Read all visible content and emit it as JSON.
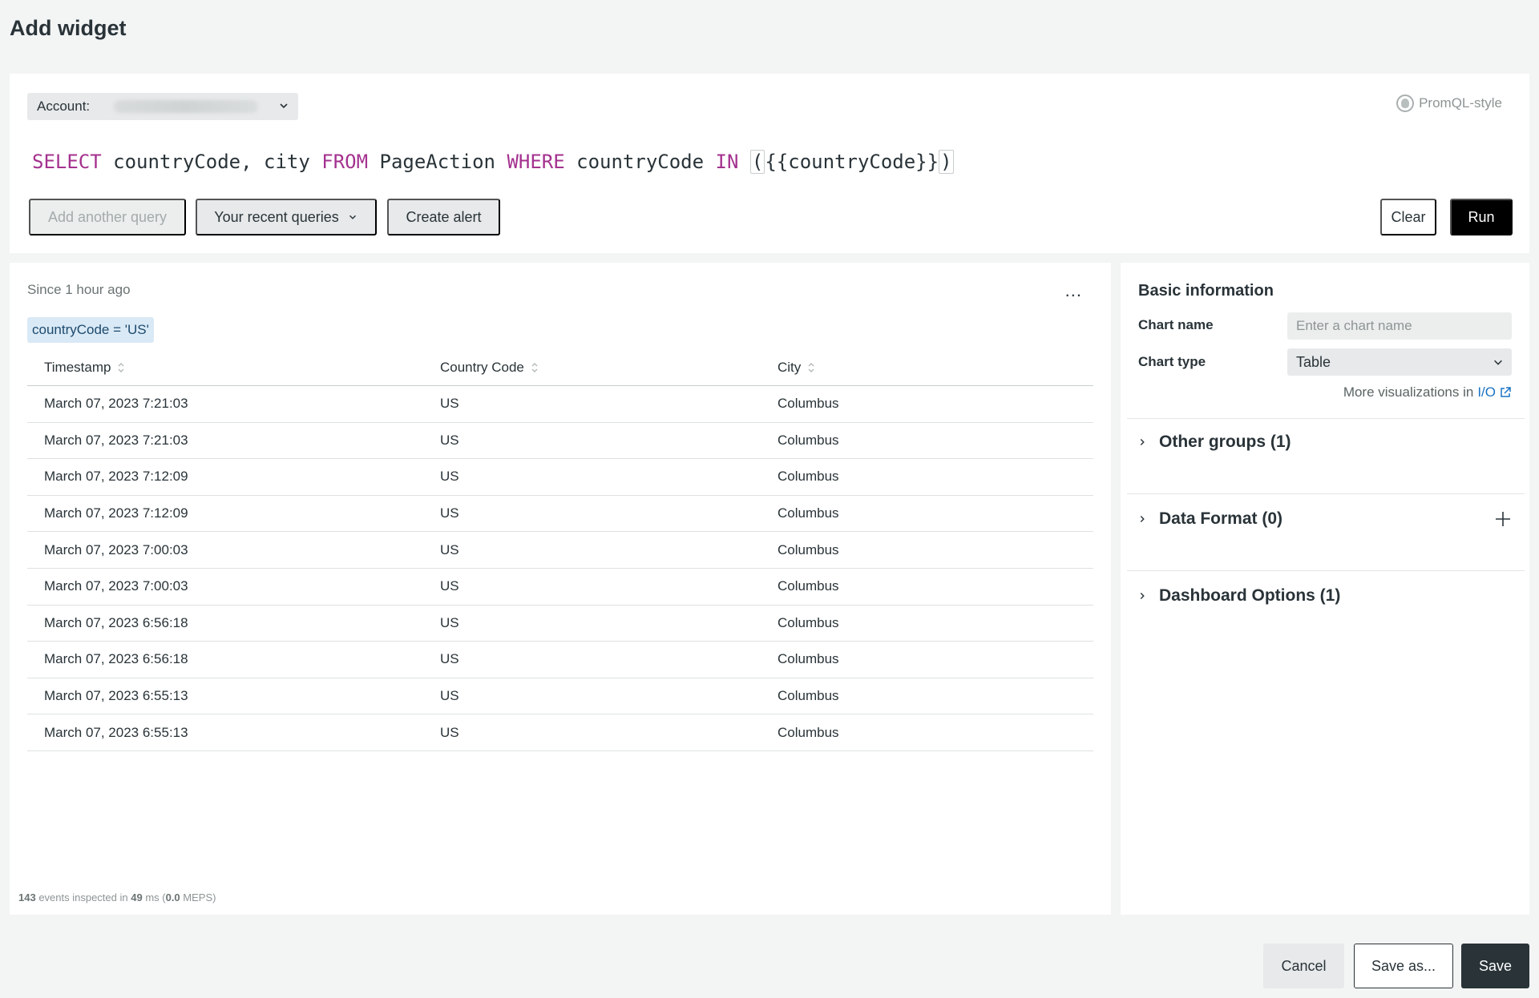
{
  "page": {
    "title": "Add widget"
  },
  "query": {
    "account_label": "Account:",
    "promql_label": "PromQL-style",
    "tokens": {
      "select": "SELECT",
      "fields": " countryCode, city ",
      "from": "FROM",
      "table": " PageAction ",
      "where": "WHERE",
      "column": " countryCode ",
      "in": "IN",
      "space": " ",
      "open_paren": "(",
      "variable": "{{countryCode}}",
      "close_paren": ")"
    },
    "buttons": {
      "add_query": "Add another query",
      "recent_queries": "Your recent queries",
      "create_alert": "Create alert",
      "clear": "Clear",
      "run": "Run"
    }
  },
  "results": {
    "time_range": "Since 1 hour ago",
    "more_menu": "...",
    "filter_chip": "countryCode = 'US'",
    "columns": [
      "Timestamp",
      "Country Code",
      "City"
    ],
    "rows": [
      [
        "March 07, 2023 7:21:03",
        "US",
        "Columbus"
      ],
      [
        "March 07, 2023 7:21:03",
        "US",
        "Columbus"
      ],
      [
        "March 07, 2023 7:12:09",
        "US",
        "Columbus"
      ],
      [
        "March 07, 2023 7:12:09",
        "US",
        "Columbus"
      ],
      [
        "March 07, 2023 7:00:03",
        "US",
        "Columbus"
      ],
      [
        "March 07, 2023 7:00:03",
        "US",
        "Columbus"
      ],
      [
        "March 07, 2023 6:56:18",
        "US",
        "Columbus"
      ],
      [
        "March 07, 2023 6:56:18",
        "US",
        "Columbus"
      ],
      [
        "March 07, 2023 6:55:13",
        "US",
        "Columbus"
      ],
      [
        "March 07, 2023 6:55:13",
        "US",
        "Columbus"
      ]
    ],
    "stats": {
      "events": "143",
      "events_text": " events inspected in ",
      "ms": "49",
      "ms_text": " ms (",
      "meps": "0.0",
      "meps_text": " MEPS)"
    }
  },
  "settings": {
    "basic_info_title": "Basic information",
    "chart_name_label": "Chart name",
    "chart_name_placeholder": "Enter a chart name",
    "chart_name_value": "",
    "chart_type_label": "Chart type",
    "chart_type_value": "Table",
    "more_viz_text": "More visualizations in",
    "more_viz_link": "I/O",
    "sections": [
      {
        "label": "Other groups (1)"
      },
      {
        "label": "Data Format (0)"
      },
      {
        "label": "Dashboard Options (1)"
      }
    ]
  },
  "footer": {
    "cancel": "Cancel",
    "save_as": "Save as...",
    "save": "Save"
  },
  "colors": {
    "keyword": "#a4328f",
    "link": "#1a73c4",
    "primary_button": "#000000",
    "save_button": "#293338",
    "chip_bg": "#d9e9f6"
  }
}
